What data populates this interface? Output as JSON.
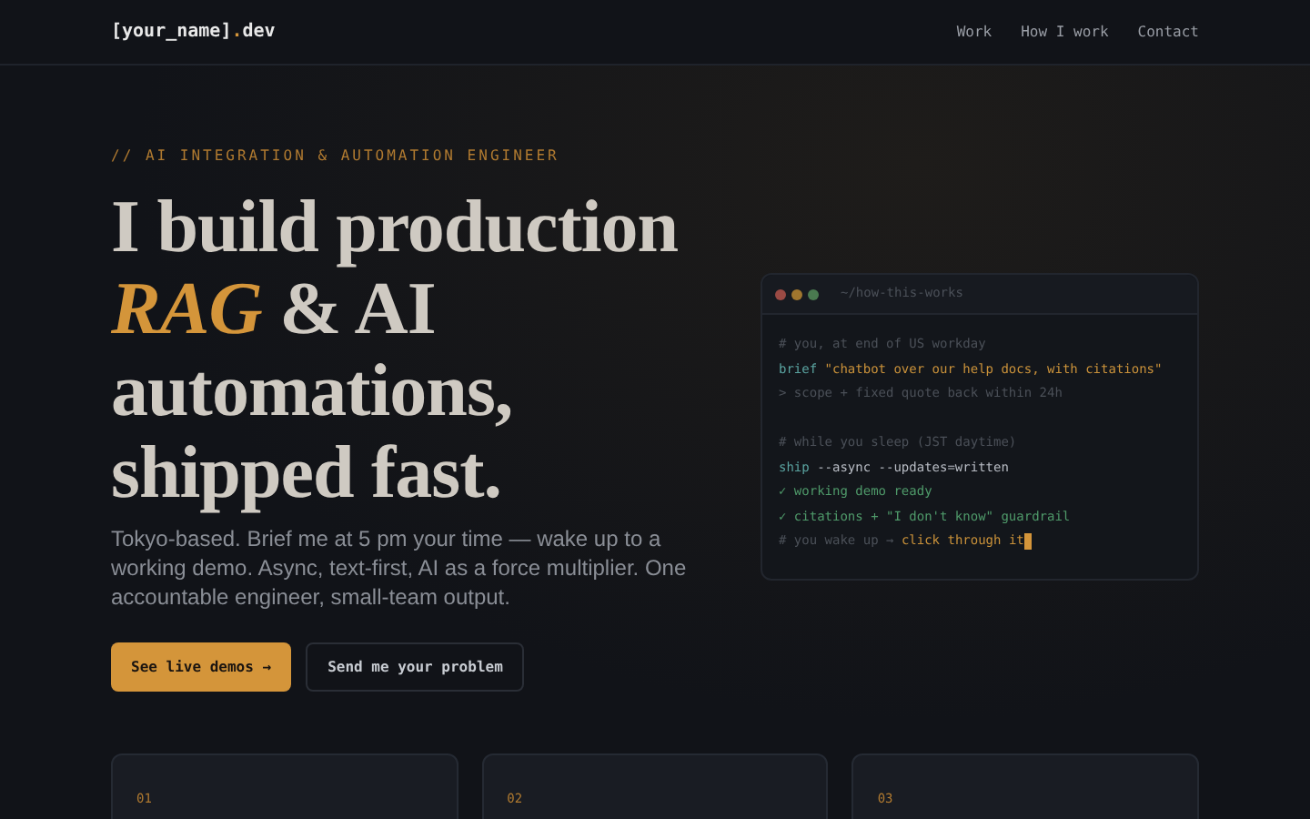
{
  "nav": {
    "logo": {
      "prefix": "[your_name]",
      "dot": ".",
      "suffix": "dev"
    },
    "links": [
      {
        "label": "Work"
      },
      {
        "label": "How I work"
      },
      {
        "label": "Contact"
      }
    ]
  },
  "hero": {
    "eyebrow": "// AI INTEGRATION & AUTOMATION ENGINEER",
    "headline": [
      {
        "segments": [
          {
            "kind": "plain",
            "text": "I build production"
          }
        ]
      },
      {
        "segments": [
          {
            "kind": "accent",
            "text": "RAG"
          },
          {
            "kind": "plain",
            "text": " & AI"
          }
        ]
      },
      {
        "segments": [
          {
            "kind": "plain",
            "text": "automations,"
          }
        ]
      },
      {
        "segments": [
          {
            "kind": "plain",
            "text": "shipped fast."
          }
        ]
      }
    ],
    "description": "Tokyo-based. Brief me at 5 pm your time — wake up to a working demo. Async, text-first, AI as a force multiplier. One accountable engineer, small-team output.",
    "buttons": [
      {
        "kind": "primary",
        "label": "See live demos →"
      },
      {
        "kind": "secondary",
        "label": "Send me your problem"
      }
    ]
  },
  "terminal": {
    "title": "~/how-this-works",
    "cursor": true,
    "lines": [
      {
        "segments": [
          {
            "kind": "comment",
            "text": "# you, at end of US workday"
          }
        ]
      },
      {
        "segments": [
          {
            "kind": "command",
            "text": "brief"
          },
          {
            "kind": "string",
            "text": " \"chatbot over our help docs, with citations\""
          }
        ]
      },
      {
        "segments": [
          {
            "kind": "comment",
            "text": "> scope + fixed quote back within 24h"
          }
        ]
      },
      {
        "kind": "blank"
      },
      {
        "segments": [
          {
            "kind": "comment",
            "text": "# while you sleep (JST daytime)"
          }
        ]
      },
      {
        "segments": [
          {
            "kind": "command",
            "text": "ship"
          },
          {
            "kind": "plain",
            "text": " --async --updates=written"
          }
        ]
      },
      {
        "segments": [
          {
            "kind": "success",
            "text": "✓ working demo ready"
          }
        ]
      },
      {
        "segments": [
          {
            "kind": "success",
            "text": "✓ citations + \"I don't know\" guardrail"
          }
        ]
      },
      {
        "segments": [
          {
            "kind": "comment",
            "text": "# you wake up → "
          },
          {
            "kind": "string",
            "text": "click through it"
          }
        ]
      }
    ]
  },
  "cards": [
    {
      "number": "01"
    },
    {
      "number": "02"
    },
    {
      "number": "03"
    }
  ]
}
